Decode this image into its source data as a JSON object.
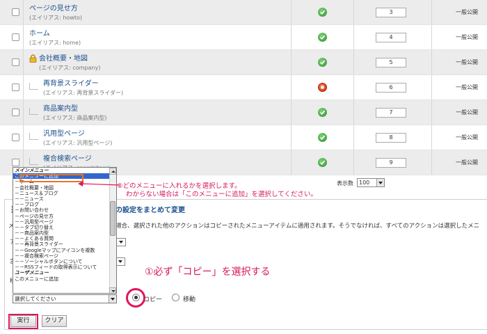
{
  "menu_items": [
    {
      "title": "ページの見せ方",
      "alias": "(エイリアス: howto)",
      "level": 0,
      "locked": false,
      "published": true,
      "order": "3",
      "access": "一般公開"
    },
    {
      "title": "ホーム",
      "alias": "(エイリアス: home)",
      "level": 0,
      "locked": false,
      "published": true,
      "order": "4",
      "access": "一般公開"
    },
    {
      "title": "会社概要・地図",
      "alias": "(エイリアス: company)",
      "level": 0,
      "locked": true,
      "published": true,
      "order": "5",
      "access": "一般公開"
    },
    {
      "title": "再背景スライダー",
      "alias": "(エイリアス: 再背景スライダー)",
      "level": 1,
      "locked": false,
      "published": false,
      "order": "6",
      "access": "一般公開"
    },
    {
      "title": "商品案内型",
      "alias": "(エイリアス: 商品案内型)",
      "level": 1,
      "locked": false,
      "published": true,
      "order": "7",
      "access": "一般公開"
    },
    {
      "title": "汎用型ページ",
      "alias": "(エイリアス: 汎用型ページ)",
      "level": 1,
      "locked": false,
      "published": true,
      "order": "8",
      "access": "一般公開"
    },
    {
      "title": "複合検索ページ",
      "alias": "(エイリアス: searchitem)",
      "level": 1,
      "locked": false,
      "published": true,
      "order": "9",
      "access": "一般公開"
    }
  ],
  "pagination": {
    "label": "表示数",
    "value": "100"
  },
  "batch": {
    "title_prefix": "選",
    "title": "の設定をまとめて変更",
    "desc_prefix": "メ",
    "desc": "場合、選択された他のアクションはコピーされたメニューアイテムに適用されます。そうでなければ、すべてのアクションは選択したメニ",
    "select_placeholder": "選択してください",
    "radio_copy": "コピー",
    "radio_move": "移動",
    "btn_execute": "実行",
    "btn_clear": "クリア"
  },
  "listbox": [
    {
      "label": "メインメニュー",
      "group": true
    },
    {
      "label": "このメニューに追加",
      "selected": true
    },
    {
      "label": "－ホーム"
    },
    {
      "label": "－会社概要・地図"
    },
    {
      "label": "－ニュース＆ブログ"
    },
    {
      "label": "－－ニュース"
    },
    {
      "label": "－－ブログ"
    },
    {
      "label": "－お問い合わせ"
    },
    {
      "label": "－ページの見せ方"
    },
    {
      "label": "－－汎用型ページ"
    },
    {
      "label": "－－タブ切り替え"
    },
    {
      "label": "－－商品案内型"
    },
    {
      "label": "－－よくある質問"
    },
    {
      "label": "－－再背景スライダー"
    },
    {
      "label": "－－Googleマップにアイコンを複数"
    },
    {
      "label": "－－複合検索ページ"
    },
    {
      "label": "－－ソーシャルボタンについて"
    },
    {
      "label": "－－RSSフィードの取得表示について"
    },
    {
      "label": "ユーザメニュー",
      "group": true
    },
    {
      "label": "このメニューに追加"
    }
  ],
  "annotations": {
    "line1": "②どのメニューに入れるかを選択します。",
    "line2": "わからない場合は「このメニューに追加」を選択してください。",
    "big": "①必ず「コピー」を選択する"
  },
  "colors": {
    "accent": "#e0155f",
    "link": "#1a4f8e",
    "highlight": "#e8761e"
  }
}
